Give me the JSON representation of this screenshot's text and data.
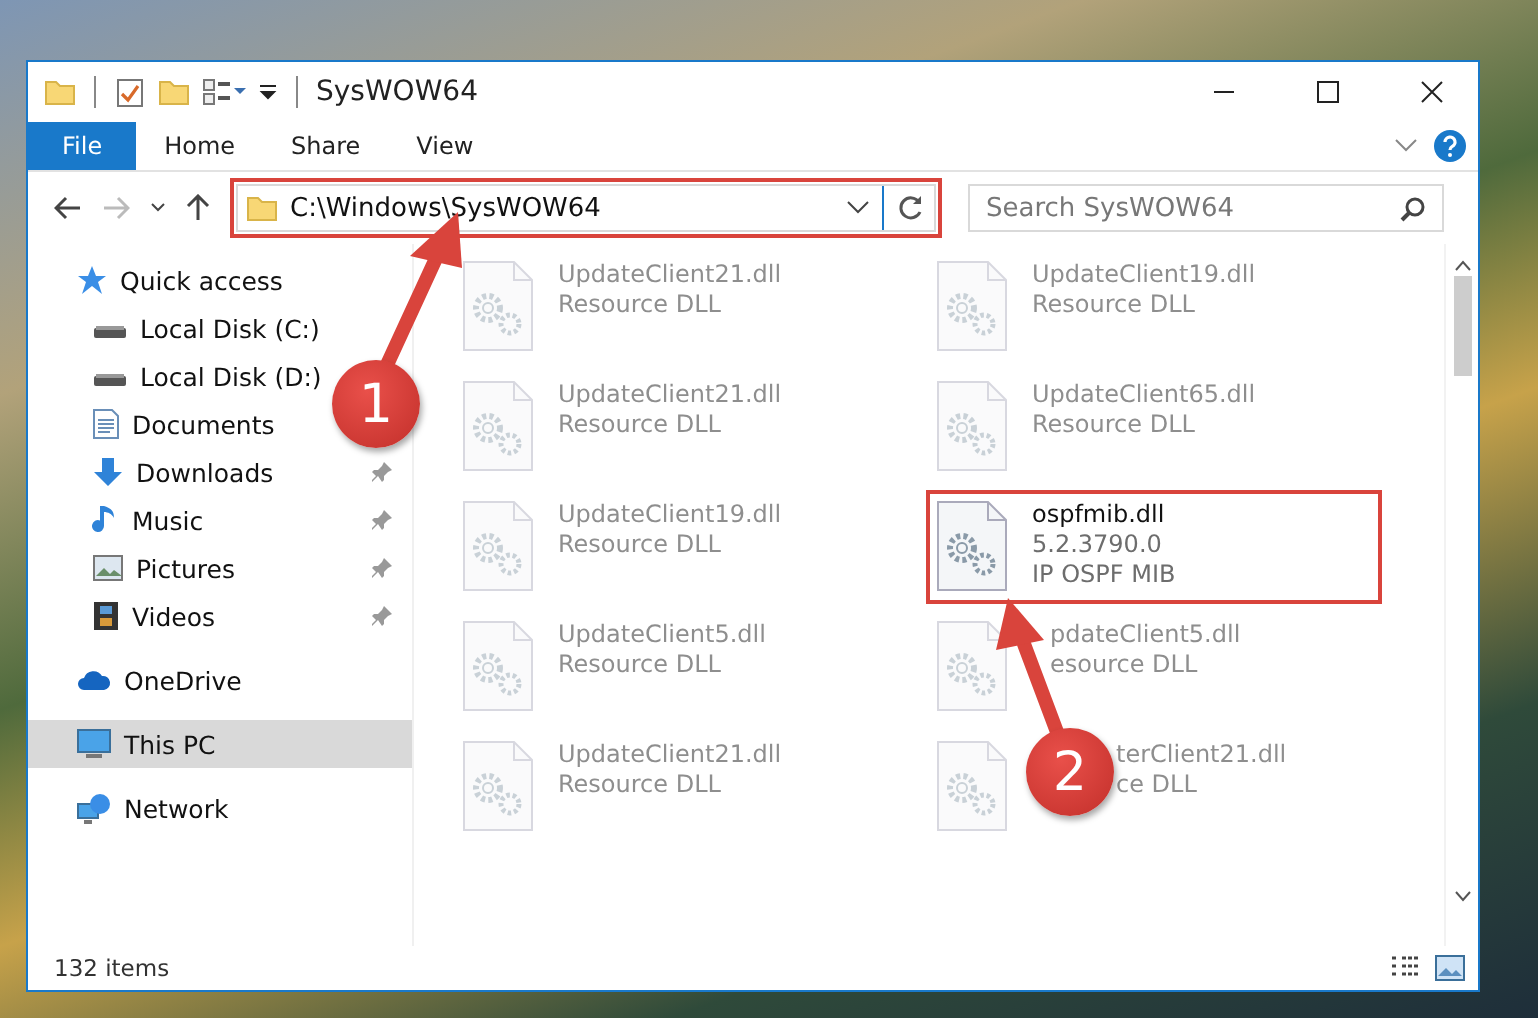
{
  "window": {
    "title": "SysWOW64"
  },
  "ribbon_tabs": [
    {
      "label": "File",
      "kind": "file",
      "selected": false
    },
    {
      "label": "Home",
      "kind": "tab",
      "selected": false
    },
    {
      "label": "Share",
      "kind": "tab",
      "selected": false
    },
    {
      "label": "View",
      "kind": "tab",
      "selected": false
    }
  ],
  "address": {
    "path": "C:\\Windows\\SysWOW64",
    "highlighted": true
  },
  "search": {
    "placeholder": "Search SysWOW64"
  },
  "nav": [
    {
      "label": "Quick access",
      "kind": "star",
      "selected": false,
      "children": [
        {
          "label": "Local Disk (C:)",
          "kind": "disk",
          "selected": false
        },
        {
          "label": "Local Disk (D:)",
          "kind": "disk",
          "selected": false
        },
        {
          "label": "Documents",
          "kind": "doc",
          "selected": false
        },
        {
          "label": "Downloads",
          "kind": "download",
          "pinned": true,
          "selected": false
        },
        {
          "label": "Music",
          "kind": "music",
          "pinned": true,
          "selected": false
        },
        {
          "label": "Pictures",
          "kind": "picture",
          "pinned": true,
          "selected": false
        },
        {
          "label": "Videos",
          "kind": "video",
          "pinned": true,
          "selected": false
        }
      ]
    },
    {
      "label": "OneDrive",
      "kind": "cloud",
      "selected": false
    },
    {
      "label": "This PC",
      "kind": "pc",
      "selected": true
    },
    {
      "label": "Network",
      "kind": "network",
      "selected": false
    }
  ],
  "files": [
    {
      "name": "UpdateClient21.dll",
      "lines": [
        "Resource DLL"
      ],
      "dimmed": true,
      "highlighted": false
    },
    {
      "name": "UpdateClient19.dll",
      "lines": [
        "Resource DLL"
      ],
      "dimmed": true,
      "highlighted": false
    },
    {
      "name": "UpdateClient21.dll",
      "lines": [
        "Resource DLL"
      ],
      "dimmed": true,
      "highlighted": false
    },
    {
      "name": "UpdateClient65.dll",
      "lines": [
        "Resource DLL"
      ],
      "dimmed": true,
      "highlighted": false
    },
    {
      "name": "UpdateClient19.dll",
      "lines": [
        "Resource DLL"
      ],
      "dimmed": true,
      "highlighted": false
    },
    {
      "name": "ospfmib.dll",
      "lines": [
        "5.2.3790.0",
        "IP OSPF MIB"
      ],
      "dimmed": false,
      "highlighted": true
    },
    {
      "name": "UpdateClient5.dll",
      "lines": [
        "Resource DLL"
      ],
      "dimmed": true,
      "highlighted": false
    },
    {
      "name": "pdateClient5.dll",
      "lines": [
        "esource DLL"
      ],
      "dimmed": true,
      "highlighted": false
    },
    {
      "name": "UpdateClient21.dll",
      "lines": [
        "Resource DLL"
      ],
      "dimmed": true,
      "highlighted": false
    },
    {
      "name": "terClient21.dll",
      "lines": [
        "ce DLL"
      ],
      "dimmed": true,
      "highlighted": false
    }
  ],
  "status_bar": {
    "item_count": "132 items"
  },
  "callouts": [
    {
      "number": "1"
    },
    {
      "number": "2"
    }
  ]
}
